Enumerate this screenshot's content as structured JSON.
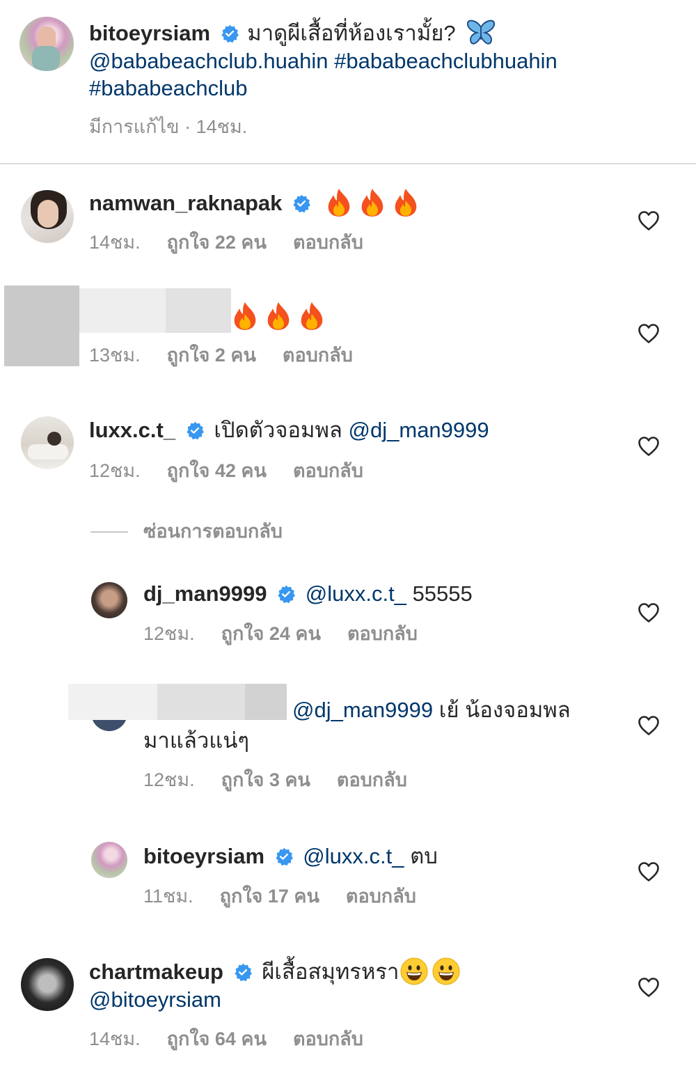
{
  "caption": {
    "username": "bitoeyrsiam",
    "text": "มาดูผีเสื้อที่ห้องเรามั้ย?",
    "mention": "@bababeachclub.huahin",
    "hashtag1": "#bababeachclubhuahin",
    "hashtag2": "#bababeachclub",
    "edited": "มีการแก้ไข",
    "time": "14ชม."
  },
  "comments": [
    {
      "username": "namwan_raknapak",
      "time": "14ชม.",
      "likes": "ถูกใจ 22 คน",
      "reply": "ตอบกลับ"
    },
    {
      "time": "13ชม.",
      "likes": "ถูกใจ 2 คน",
      "reply": "ตอบกลับ"
    },
    {
      "username": "luxx.c.t_",
      "text": "เปิดตัวจอมพล",
      "mention": "@dj_man9999",
      "time": "12ชม.",
      "likes": "ถูกใจ 42 คน",
      "reply": "ตอบกลับ"
    },
    {
      "username": "chartmakeup",
      "text": "ผีเสื้อสมุทรหรา",
      "mention": "@bitoeyrsiam",
      "time": "14ชม.",
      "likes": "ถูกใจ 64 คน",
      "reply": "ตอบกลับ"
    }
  ],
  "hide_replies": "ซ่อนการตอบกลับ",
  "replies": [
    {
      "username": "dj_man9999",
      "mention": "@luxx.c.t_",
      "text": "55555",
      "time": "12ชม.",
      "likes": "ถูกใจ 24 คน",
      "reply": "ตอบกลับ"
    },
    {
      "mention": "@dj_man9999",
      "text": "เย้ น้องจอมพล",
      "text2": "มาแล้วแน่ๆ",
      "time": "12ชม.",
      "likes": "ถูกใจ 3 คน",
      "reply": "ตอบกลับ"
    },
    {
      "username": "bitoeyrsiam",
      "mention": "@luxx.c.t_",
      "text": "ตบ",
      "time": "11ชม.",
      "likes": "ถูกใจ 17 คน",
      "reply": "ตอบกลับ"
    }
  ],
  "colors": {
    "verified": "#3897f0",
    "mention": "#00376b",
    "meta": "#8e8e8e"
  }
}
